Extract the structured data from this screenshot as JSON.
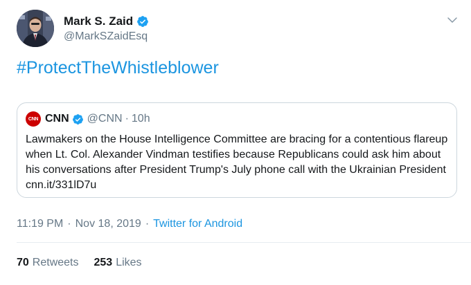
{
  "author": {
    "name": "Mark S. Zaid",
    "handle": "@MarkSZaidEsq",
    "avatar_icon": "user-avatar",
    "verified": true
  },
  "tweet": {
    "hashtag": "#ProtectTheWhistleblower"
  },
  "quoted_tweet": {
    "logo_text": "CNN",
    "name": "CNN",
    "handle": "@CNN",
    "separator": "·",
    "time": "10h",
    "text": "Lawmakers on the House Intelligence Committee are bracing for a contentious flareup when Lt. Col. Alexander Vindman testifies because Republicans could ask him about his conversations after President Trump's July phone call with the Ukrainian President cnn.it/331lD7u"
  },
  "meta": {
    "time": "11:19 PM",
    "separator": "·",
    "date": "Nov 18, 2019",
    "source": "Twitter for Android"
  },
  "stats": {
    "retweets_count": "70",
    "retweets_label": "Retweets",
    "likes_count": "253",
    "likes_label": "Likes"
  },
  "colors": {
    "link": "#1b95e0",
    "secondary_text": "#657786",
    "verified_badge": "#1da1f2",
    "cnn_red": "#cc0000",
    "border": "#ccd6dd"
  },
  "icons": {
    "menu": "chevron-down-icon",
    "verified": "verified-badge-icon"
  }
}
